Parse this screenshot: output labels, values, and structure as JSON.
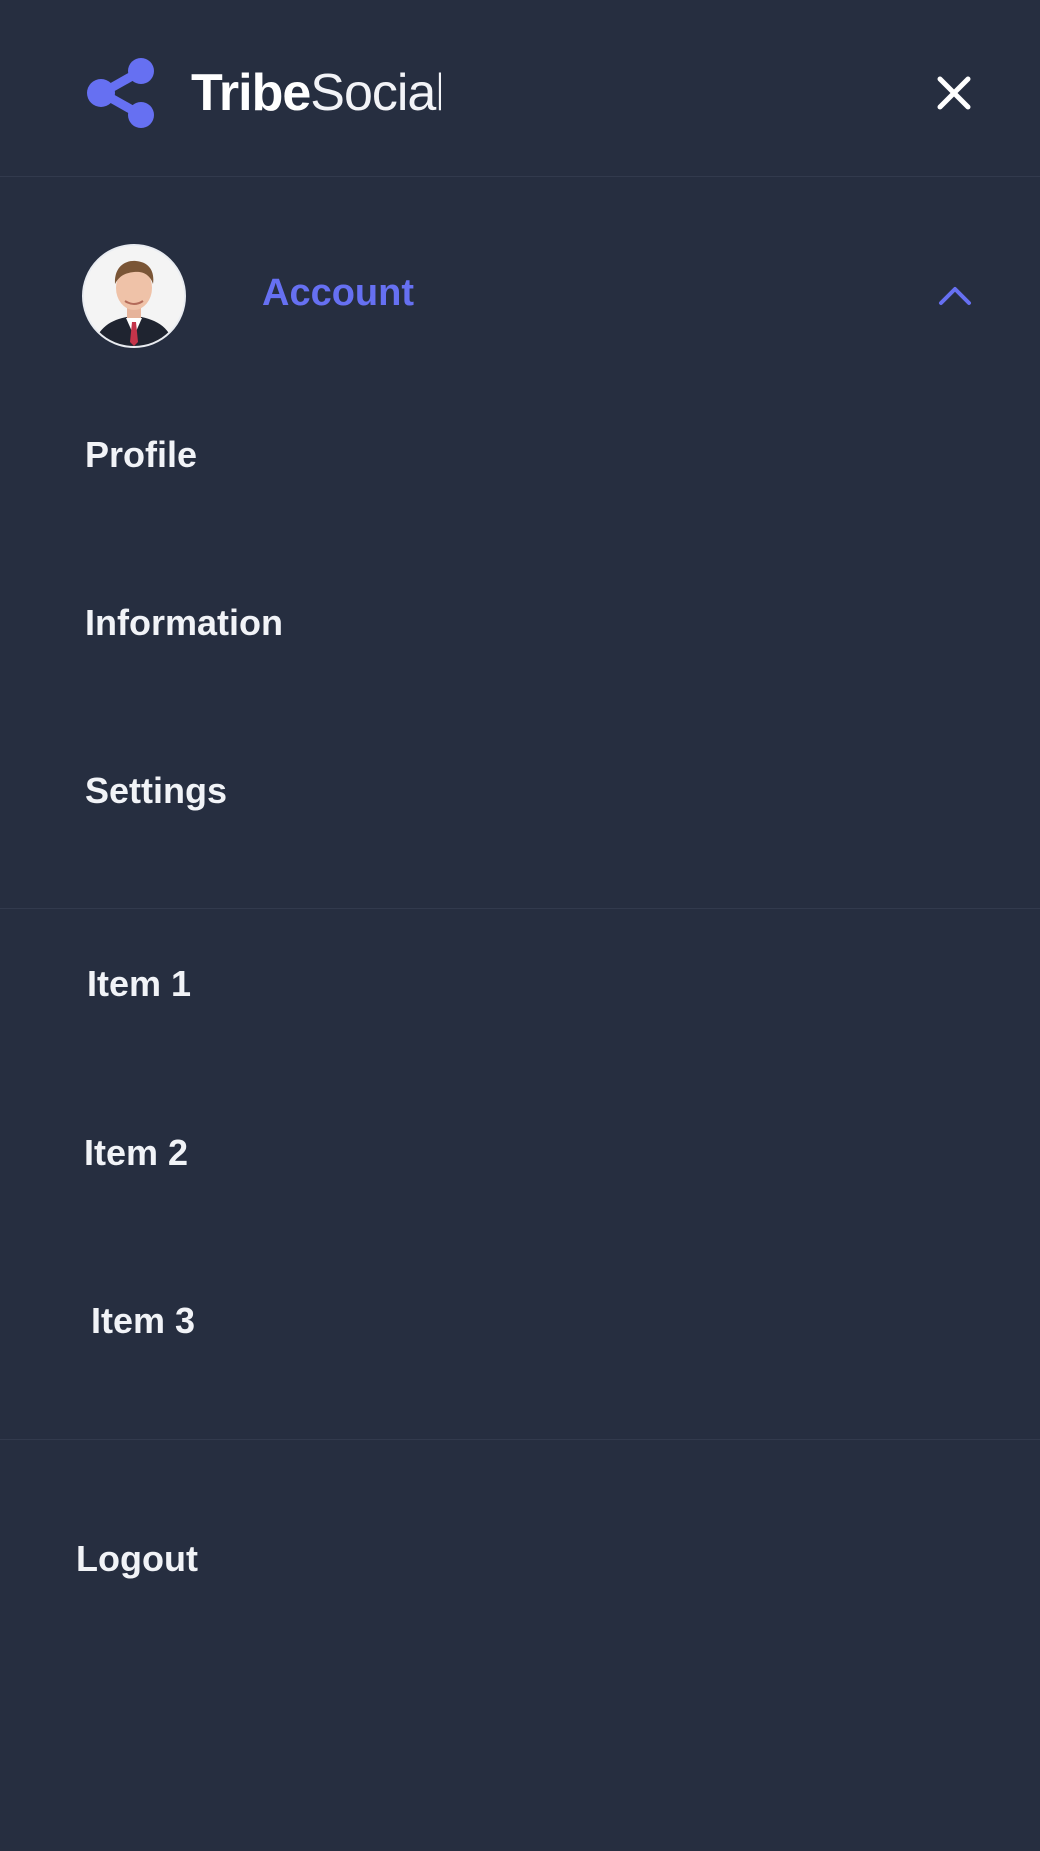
{
  "header": {
    "brand_bold": "Tribe",
    "brand_light": "Social",
    "logo_icon": "share-icon",
    "close_icon": "close-icon"
  },
  "account": {
    "label": "Account",
    "avatar": "avatar",
    "chevron_icon": "chevron-up-icon",
    "items": [
      {
        "label": "Profile"
      },
      {
        "label": "Information"
      },
      {
        "label": "Settings"
      }
    ]
  },
  "menu": {
    "items": [
      {
        "label": "Item 1"
      },
      {
        "label": "Item 2"
      },
      {
        "label": "Item 3"
      }
    ]
  },
  "footer": {
    "logout_label": "Logout"
  },
  "colors": {
    "background": "#262e40",
    "accent": "#6670f2",
    "text": "#f1f3f7",
    "divider": "#323a4d"
  }
}
